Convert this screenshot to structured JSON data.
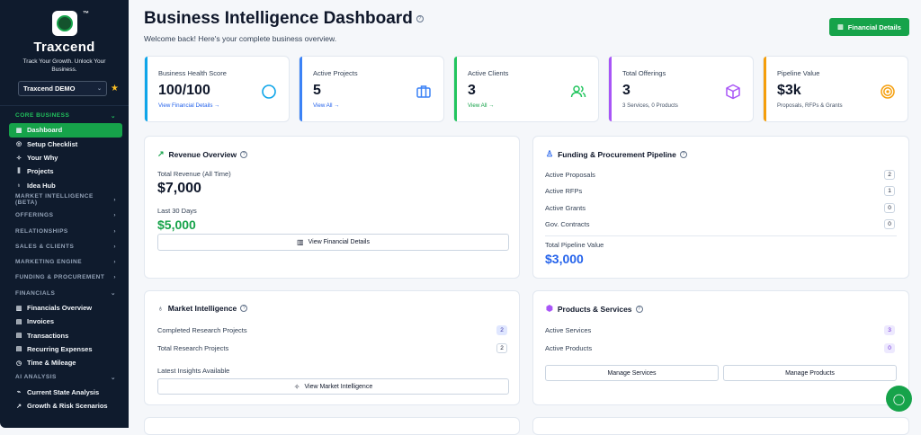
{
  "sidebar": {
    "brand": "Traxcend",
    "tm": "™",
    "tagline": "Track Your Growth. Unlock Your Business.",
    "demo": "Traxcend DEMO",
    "sections": [
      {
        "label": "CORE BUSINESS",
        "items": [
          "Dashboard",
          "Setup Checklist",
          "Your Why",
          "Projects",
          "Idea Hub"
        ]
      },
      {
        "label": "MARKET INTELLIGENCE (BETA)"
      },
      {
        "label": "OFFERINGS"
      },
      {
        "label": "RELATIONSHIPS"
      },
      {
        "label": "SALES & CLIENTS"
      },
      {
        "label": "MARKETING ENGINE"
      },
      {
        "label": "FUNDING & PROCUREMENT"
      },
      {
        "label": "FINANCIALS",
        "items": [
          "Financials Overview",
          "Invoices",
          "Transactions",
          "Recurring Expenses",
          "Time & Mileage"
        ]
      },
      {
        "label": "AI ANALYSIS",
        "items": [
          "Current State Analysis",
          "Growth & Risk Scenarios"
        ]
      }
    ]
  },
  "header": {
    "title": "Business Intelligence Dashboard",
    "welcome": "Welcome back! Here's your complete business overview.",
    "financial_details_btn": "Financial Details"
  },
  "stats": [
    {
      "label": "Business Health Score",
      "value": "100/100",
      "sub": "View Financial Details →",
      "color": "#0ea5e9",
      "icon": "circle-icon"
    },
    {
      "label": "Active Projects",
      "value": "5",
      "sub": "View All →",
      "color": "#3b82f6",
      "icon": "briefcase-icon"
    },
    {
      "label": "Active Clients",
      "value": "3",
      "sub": "View All →",
      "color": "#22c55e",
      "icon": "users-icon"
    },
    {
      "label": "Total Offerings",
      "value": "3",
      "sub": "3 Services, 0 Products",
      "color": "#a855f7",
      "icon": "package-icon"
    },
    {
      "label": "Pipeline Value",
      "value": "$3k",
      "sub": "Proposals, RFPs & Grants",
      "color": "#f59e0b",
      "icon": "target-icon"
    }
  ],
  "revenue": {
    "title": "Revenue Overview",
    "total_label": "Total Revenue (All Time)",
    "total_value": "$7,000",
    "last30_label": "Last 30 Days",
    "last30_value": "$5,000",
    "button": "View Financial Details"
  },
  "funding": {
    "title": "Funding & Procurement Pipeline",
    "rows": [
      {
        "label": "Active Proposals",
        "value": "2"
      },
      {
        "label": "Active RFPs",
        "value": "1"
      },
      {
        "label": "Active Grants",
        "value": "0"
      },
      {
        "label": "Gov. Contracts",
        "value": "0"
      }
    ],
    "total_label": "Total Pipeline Value",
    "total_value": "$3,000"
  },
  "market": {
    "title": "Market Intelligence",
    "rows": [
      {
        "label": "Completed Research Projects",
        "value": "2"
      },
      {
        "label": "Total Research Projects",
        "value": "2"
      }
    ],
    "insights_label": "Latest Insights Available",
    "button": "View Market Intelligence"
  },
  "products": {
    "title": "Products & Services",
    "rows": [
      {
        "label": "Active Services",
        "value": "3"
      },
      {
        "label": "Active Products",
        "value": "0"
      }
    ],
    "manage_services": "Manage Services",
    "manage_products": "Manage Products"
  }
}
